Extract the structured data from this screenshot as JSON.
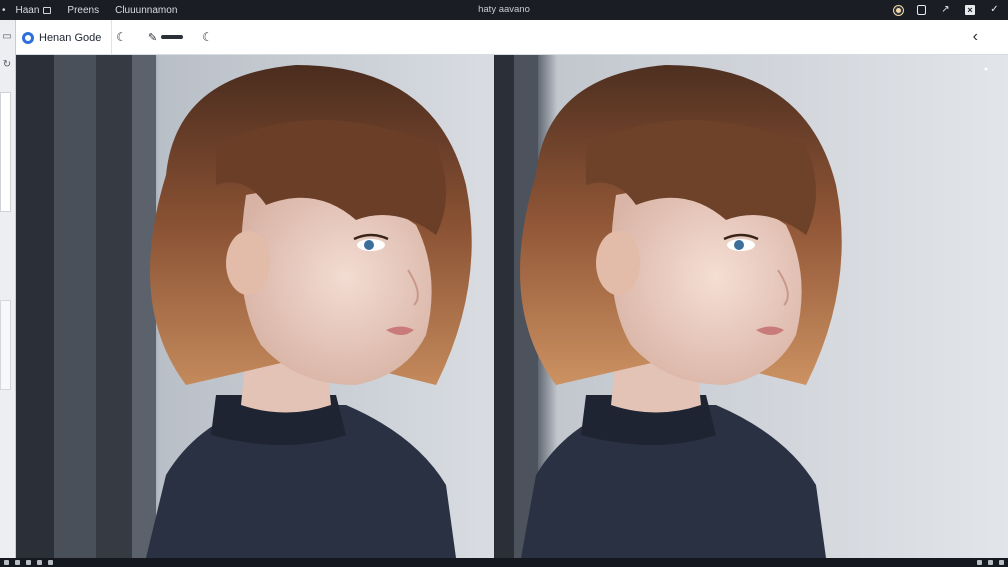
{
  "titlebar": {
    "menu": [
      {
        "label": "Haan"
      },
      {
        "label": "Preens"
      },
      {
        "label": "Cluuunnamon"
      }
    ],
    "window_title": "haty aavano",
    "tray_icons": [
      "status-dot-icon",
      "document-icon",
      "pen-icon",
      "close-box-icon",
      "check-icon"
    ]
  },
  "toolbar": {
    "brand_label": "Henan Gode",
    "tools": [
      "undo-icon",
      "pen-tool-icon",
      "redo-icon"
    ],
    "collapse_icon": "chevron-left-icon"
  },
  "canvas": {
    "panes": [
      "original-image",
      "edited-image"
    ]
  },
  "colors": {
    "titlebar_bg": "#1a1d23",
    "toolbar_bg": "#ffffff",
    "brand_accent": "#2f6fdb",
    "hair": "#7a4a30",
    "sweater": "#2a3142"
  }
}
